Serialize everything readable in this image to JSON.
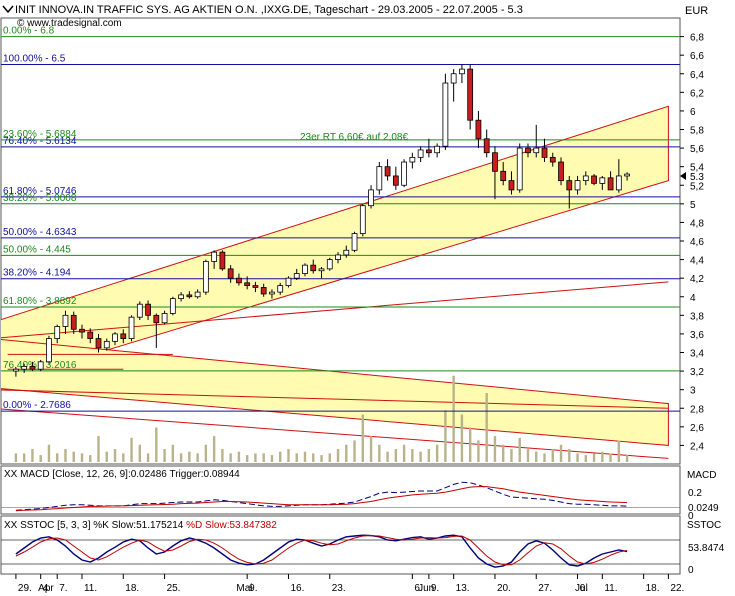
{
  "header": {
    "title": "INIT INNOVA.IN TRAFFIC SYS. AG AKTIEN O.N. ,IXXG.DE, Tageschart - 29.03.2005 - 22.07.2005 - 5.3",
    "source": "© www.tradesignal.com",
    "currency": "EUR"
  },
  "main_panel": {
    "y_ticks": [
      "6,8",
      "6,6",
      "6,4",
      "6,2",
      "6",
      "5,8",
      "5,6",
      "5,4",
      "5,2",
      "5",
      "4,8",
      "4,6",
      "4,4",
      "4,2",
      "4",
      "3,8",
      "3,6",
      "3,4",
      "3,2",
      "3",
      "2,8",
      "2,6",
      "2,4"
    ],
    "last_price_label": "5.3",
    "annotation": "23er RT 6,60€ auf 2,08€",
    "fib_labels_left": [
      {
        "text": "0.00% - 6.8",
        "price": 6.8,
        "color": "#1a8a1a"
      },
      {
        "text": "100.00% - 6.5",
        "price": 6.5,
        "color": "#1010a0"
      },
      {
        "text": "23.60% - 5.6884",
        "price": 5.6884,
        "color": "#1a8a1a"
      },
      {
        "text": "76.40% - 5.6134",
        "price": 5.6134,
        "color": "#1010a0"
      },
      {
        "text": "61.80% - 5.0746",
        "price": 5.0746,
        "color": "#1010a0"
      },
      {
        "text": "38.20% - 5.0008",
        "price": 5.0008,
        "color": "#1a8a1a"
      },
      {
        "text": "50.00% - 4.6343",
        "price": 4.6343,
        "color": "#1010a0"
      },
      {
        "text": "50.00% - 4.445",
        "price": 4.445,
        "color": "#1a8a1a"
      },
      {
        "text": "38.20% - 4.194",
        "price": 4.194,
        "color": "#1010a0"
      },
      {
        "text": "61.80% - 3.8892",
        "price": 3.8892,
        "color": "#1a8a1a"
      },
      {
        "text": "76.40% - 3.2016",
        "price": 3.2016,
        "color": "#1a8a1a"
      },
      {
        "text": "0.00% - 2.7686",
        "price": 2.7686,
        "color": "#1010a0"
      }
    ]
  },
  "macd_panel": {
    "label": "XX MACD [Close, 12, 26, 9]:0.02486 Trigger:0.08944",
    "right_title": "MACD",
    "tick_02": "0.2",
    "tick_0": "0",
    "value_label": "0.0249"
  },
  "stoch_panel": {
    "label_prefix": "XX SSTOC [5, 3, 3] %K Slow:51.175214",
    "label_suffix": " %D Slow:53.847382",
    "right_title": "SSTOC",
    "value_label": "53.8474",
    "tick_0": "0"
  },
  "x_axis": {
    "day_ticks": [
      "29.",
      "4",
      "7.",
      "11.",
      "18.",
      "25.",
      "9.",
      "16.",
      "23.",
      "6.",
      "9.",
      "13.",
      "20.",
      "27.",
      "6.",
      "11.",
      "18.",
      "22."
    ],
    "month_labels": [
      "Apr",
      "Mai",
      "Jun",
      "Jul"
    ]
  },
  "colors": {
    "channel_fill": "#fffbb0",
    "up_candle": "#ffffff",
    "down_candle": "#c81e1e",
    "volume": "#b8b38a",
    "fib_green": "#1a8a1a",
    "fib_blue": "#1010a0",
    "trend_red": "#d01010",
    "macd_line": "#00007a",
    "macd_signal": "#c80000"
  },
  "chart_data": {
    "type": "candlestick",
    "title": "INIT INNOVA.IN TRAFFIC SYS. AG AKTIEN O.N. ,IXXG.DE, Tageschart - 29.03.2005 - 22.07.2005 - 5.3",
    "ylabel": "EUR",
    "ylim": [
      2.2,
      7.0
    ],
    "candles": [
      {
        "o": 3.2,
        "h": 3.24,
        "l": 3.14,
        "c": 3.22
      },
      {
        "o": 3.22,
        "h": 3.28,
        "l": 3.18,
        "c": 3.25
      },
      {
        "o": 3.25,
        "h": 3.3,
        "l": 3.2,
        "c": 3.22
      },
      {
        "o": 3.22,
        "h": 3.32,
        "l": 3.2,
        "c": 3.3
      },
      {
        "o": 3.3,
        "h": 3.58,
        "l": 3.28,
        "c": 3.55
      },
      {
        "o": 3.55,
        "h": 3.7,
        "l": 3.5,
        "c": 3.68
      },
      {
        "o": 3.68,
        "h": 3.85,
        "l": 3.6,
        "c": 3.8
      },
      {
        "o": 3.8,
        "h": 3.84,
        "l": 3.6,
        "c": 3.65
      },
      {
        "o": 3.65,
        "h": 3.7,
        "l": 3.55,
        "c": 3.62
      },
      {
        "o": 3.62,
        "h": 3.66,
        "l": 3.5,
        "c": 3.55
      },
      {
        "o": 3.55,
        "h": 3.6,
        "l": 3.4,
        "c": 3.45
      },
      {
        "o": 3.45,
        "h": 3.55,
        "l": 3.42,
        "c": 3.52
      },
      {
        "o": 3.52,
        "h": 3.62,
        "l": 3.48,
        "c": 3.6
      },
      {
        "o": 3.6,
        "h": 3.65,
        "l": 3.5,
        "c": 3.55
      },
      {
        "o": 3.55,
        "h": 3.8,
        "l": 3.52,
        "c": 3.78
      },
      {
        "o": 3.78,
        "h": 3.95,
        "l": 3.75,
        "c": 3.92
      },
      {
        "o": 3.92,
        "h": 3.96,
        "l": 3.75,
        "c": 3.8
      },
      {
        "o": 3.8,
        "h": 3.82,
        "l": 3.45,
        "c": 3.72
      },
      {
        "o": 3.72,
        "h": 3.85,
        "l": 3.7,
        "c": 3.82
      },
      {
        "o": 3.82,
        "h": 4.0,
        "l": 3.8,
        "c": 3.98
      },
      {
        "o": 3.98,
        "h": 4.05,
        "l": 3.95,
        "c": 4.02
      },
      {
        "o": 4.02,
        "h": 4.06,
        "l": 3.98,
        "c": 4.0
      },
      {
        "o": 4.0,
        "h": 4.08,
        "l": 3.98,
        "c": 4.05
      },
      {
        "o": 4.05,
        "h": 4.4,
        "l": 4.02,
        "c": 4.38
      },
      {
        "o": 4.38,
        "h": 4.5,
        "l": 4.3,
        "c": 4.48
      },
      {
        "o": 4.48,
        "h": 4.5,
        "l": 4.28,
        "c": 4.3
      },
      {
        "o": 4.3,
        "h": 4.34,
        "l": 4.15,
        "c": 4.2
      },
      {
        "o": 4.2,
        "h": 4.25,
        "l": 4.12,
        "c": 4.15
      },
      {
        "o": 4.15,
        "h": 4.22,
        "l": 4.08,
        "c": 4.12
      },
      {
        "o": 4.12,
        "h": 4.16,
        "l": 4.05,
        "c": 4.1
      },
      {
        "o": 4.1,
        "h": 4.14,
        "l": 4.0,
        "c": 4.03
      },
      {
        "o": 4.03,
        "h": 4.08,
        "l": 3.98,
        "c": 4.05
      },
      {
        "o": 4.05,
        "h": 4.15,
        "l": 4.02,
        "c": 4.12
      },
      {
        "o": 4.12,
        "h": 4.22,
        "l": 4.1,
        "c": 4.2
      },
      {
        "o": 4.2,
        "h": 4.3,
        "l": 4.18,
        "c": 4.25
      },
      {
        "o": 4.25,
        "h": 4.36,
        "l": 4.22,
        "c": 4.34
      },
      {
        "o": 4.34,
        "h": 4.4,
        "l": 4.25,
        "c": 4.28
      },
      {
        "o": 4.28,
        "h": 4.32,
        "l": 4.2,
        "c": 4.3
      },
      {
        "o": 4.3,
        "h": 4.42,
        "l": 4.28,
        "c": 4.4
      },
      {
        "o": 4.4,
        "h": 4.48,
        "l": 4.36,
        "c": 4.45
      },
      {
        "o": 4.45,
        "h": 4.55,
        "l": 4.42,
        "c": 4.5
      },
      {
        "o": 4.5,
        "h": 4.7,
        "l": 4.48,
        "c": 4.68
      },
      {
        "o": 4.68,
        "h": 5.0,
        "l": 4.65,
        "c": 4.98
      },
      {
        "o": 4.98,
        "h": 5.2,
        "l": 4.95,
        "c": 5.15
      },
      {
        "o": 5.15,
        "h": 5.45,
        "l": 5.1,
        "c": 5.4
      },
      {
        "o": 5.4,
        "h": 5.48,
        "l": 5.25,
        "c": 5.3
      },
      {
        "o": 5.3,
        "h": 5.4,
        "l": 5.15,
        "c": 5.2
      },
      {
        "o": 5.2,
        "h": 5.48,
        "l": 5.18,
        "c": 5.45
      },
      {
        "o": 5.45,
        "h": 5.55,
        "l": 5.38,
        "c": 5.5
      },
      {
        "o": 5.5,
        "h": 5.62,
        "l": 5.45,
        "c": 5.58
      },
      {
        "o": 5.58,
        "h": 5.7,
        "l": 5.5,
        "c": 5.55
      },
      {
        "o": 5.55,
        "h": 5.65,
        "l": 5.5,
        "c": 5.62
      },
      {
        "o": 5.62,
        "h": 6.4,
        "l": 5.58,
        "c": 6.3
      },
      {
        "o": 6.3,
        "h": 6.45,
        "l": 6.1,
        "c": 6.4
      },
      {
        "o": 6.4,
        "h": 6.5,
        "l": 6.3,
        "c": 6.45
      },
      {
        "o": 6.45,
        "h": 6.5,
        "l": 5.8,
        "c": 5.9
      },
      {
        "o": 5.9,
        "h": 6.0,
        "l": 5.6,
        "c": 5.7
      },
      {
        "o": 5.7,
        "h": 5.8,
        "l": 5.5,
        "c": 5.55
      },
      {
        "o": 5.55,
        "h": 5.62,
        "l": 5.05,
        "c": 5.35
      },
      {
        "o": 5.35,
        "h": 5.45,
        "l": 5.2,
        "c": 5.25
      },
      {
        "o": 5.25,
        "h": 5.35,
        "l": 5.1,
        "c": 5.15
      },
      {
        "o": 5.15,
        "h": 5.65,
        "l": 5.12,
        "c": 5.6
      },
      {
        "o": 5.6,
        "h": 5.65,
        "l": 5.5,
        "c": 5.55
      },
      {
        "o": 5.55,
        "h": 5.85,
        "l": 5.5,
        "c": 5.6
      },
      {
        "o": 5.6,
        "h": 5.7,
        "l": 5.45,
        "c": 5.5
      },
      {
        "o": 5.5,
        "h": 5.55,
        "l": 5.4,
        "c": 5.45
      },
      {
        "o": 5.45,
        "h": 5.5,
        "l": 5.2,
        "c": 5.25
      },
      {
        "o": 5.25,
        "h": 5.3,
        "l": 4.95,
        "c": 5.15
      },
      {
        "o": 5.15,
        "h": 5.3,
        "l": 5.1,
        "c": 5.25
      },
      {
        "o": 5.25,
        "h": 5.35,
        "l": 5.2,
        "c": 5.3
      },
      {
        "o": 5.3,
        "h": 5.32,
        "l": 5.2,
        "c": 5.22
      },
      {
        "o": 5.22,
        "h": 5.3,
        "l": 5.15,
        "c": 5.28
      },
      {
        "o": 5.28,
        "h": 5.35,
        "l": 5.2,
        "c": 5.15
      },
      {
        "o": 5.15,
        "h": 5.48,
        "l": 5.12,
        "c": 5.3
      },
      {
        "o": 5.3,
        "h": 5.34,
        "l": 5.25,
        "c": 5.32
      }
    ],
    "volume_relative": [
      0.1,
      0.1,
      0.15,
      0.08,
      0.2,
      0.1,
      0.15,
      0.12,
      0.1,
      0.08,
      0.3,
      0.12,
      0.15,
      0.1,
      0.28,
      0.2,
      0.1,
      0.4,
      0.15,
      0.2,
      0.1,
      0.12,
      0.1,
      0.2,
      0.3,
      0.15,
      0.1,
      0.12,
      0.08,
      0.1,
      0.1,
      0.08,
      0.12,
      0.15,
      0.1,
      0.12,
      0.1,
      0.08,
      0.1,
      0.15,
      0.2,
      0.25,
      0.55,
      0.3,
      0.2,
      0.12,
      0.15,
      0.2,
      0.15,
      0.12,
      0.15,
      0.2,
      0.6,
      1.0,
      0.55,
      0.4,
      0.25,
      0.8,
      0.3,
      0.2,
      0.15,
      0.28,
      0.15,
      0.12,
      0.1,
      0.15,
      0.2,
      0.15,
      0.1,
      0.08,
      0.1,
      0.12,
      0.1,
      0.25,
      0.08
    ],
    "macd": [
      -0.05,
      -0.04,
      -0.03,
      -0.02,
      0.0,
      0.02,
      0.04,
      0.05,
      0.05,
      0.04,
      0.03,
      0.03,
      0.03,
      0.03,
      0.05,
      0.07,
      0.07,
      0.07,
      0.08,
      0.09,
      0.1,
      0.1,
      0.1,
      0.12,
      0.14,
      0.13,
      0.11,
      0.09,
      0.07,
      0.05,
      0.03,
      0.02,
      0.02,
      0.03,
      0.04,
      0.05,
      0.05,
      0.05,
      0.06,
      0.07,
      0.08,
      0.1,
      0.15,
      0.2,
      0.26,
      0.28,
      0.27,
      0.28,
      0.29,
      0.3,
      0.3,
      0.3,
      0.36,
      0.42,
      0.46,
      0.45,
      0.41,
      0.36,
      0.3,
      0.24,
      0.19,
      0.18,
      0.17,
      0.16,
      0.15,
      0.13,
      0.1,
      0.07,
      0.06,
      0.06,
      0.05,
      0.04,
      0.03,
      0.03,
      0.025
    ],
    "macd_trigger": [
      -0.06,
      -0.05,
      -0.045,
      -0.04,
      -0.03,
      -0.02,
      -0.01,
      0.0,
      0.01,
      0.02,
      0.02,
      0.025,
      0.03,
      0.03,
      0.035,
      0.04,
      0.045,
      0.05,
      0.055,
      0.06,
      0.07,
      0.075,
      0.08,
      0.09,
      0.1,
      0.11,
      0.11,
      0.105,
      0.1,
      0.09,
      0.08,
      0.07,
      0.06,
      0.05,
      0.05,
      0.05,
      0.05,
      0.05,
      0.05,
      0.055,
      0.06,
      0.07,
      0.09,
      0.11,
      0.14,
      0.17,
      0.19,
      0.21,
      0.23,
      0.24,
      0.25,
      0.26,
      0.28,
      0.31,
      0.34,
      0.37,
      0.38,
      0.38,
      0.36,
      0.34,
      0.31,
      0.28,
      0.26,
      0.24,
      0.22,
      0.2,
      0.18,
      0.16,
      0.14,
      0.13,
      0.12,
      0.11,
      0.1,
      0.095,
      0.089
    ],
    "stoch_k": [
      45,
      60,
      75,
      85,
      88,
      80,
      65,
      45,
      30,
      25,
      35,
      50,
      62,
      75,
      82,
      78,
      60,
      45,
      50,
      65,
      78,
      85,
      80,
      72,
      60,
      45,
      30,
      22,
      18,
      20,
      30,
      45,
      60,
      75,
      82,
      80,
      72,
      65,
      70,
      80,
      88,
      90,
      92,
      91,
      88,
      80,
      78,
      82,
      86,
      88,
      82,
      85,
      90,
      92,
      88,
      60,
      35,
      20,
      12,
      15,
      25,
      50,
      70,
      78,
      72,
      55,
      35,
      18,
      15,
      22,
      35,
      45,
      50,
      55,
      51
    ],
    "stoch_d": [
      40,
      50,
      62,
      75,
      83,
      85,
      80,
      65,
      50,
      35,
      30,
      38,
      50,
      62,
      72,
      80,
      75,
      62,
      52,
      55,
      65,
      76,
      82,
      80,
      72,
      60,
      45,
      32,
      24,
      20,
      22,
      30,
      45,
      60,
      72,
      80,
      78,
      72,
      68,
      70,
      78,
      85,
      90,
      91,
      90,
      86,
      82,
      80,
      82,
      85,
      86,
      85,
      86,
      89,
      90,
      80,
      60,
      40,
      25,
      18,
      18,
      30,
      48,
      65,
      73,
      70,
      58,
      40,
      25,
      20,
      24,
      32,
      42,
      50,
      53.8
    ]
  }
}
